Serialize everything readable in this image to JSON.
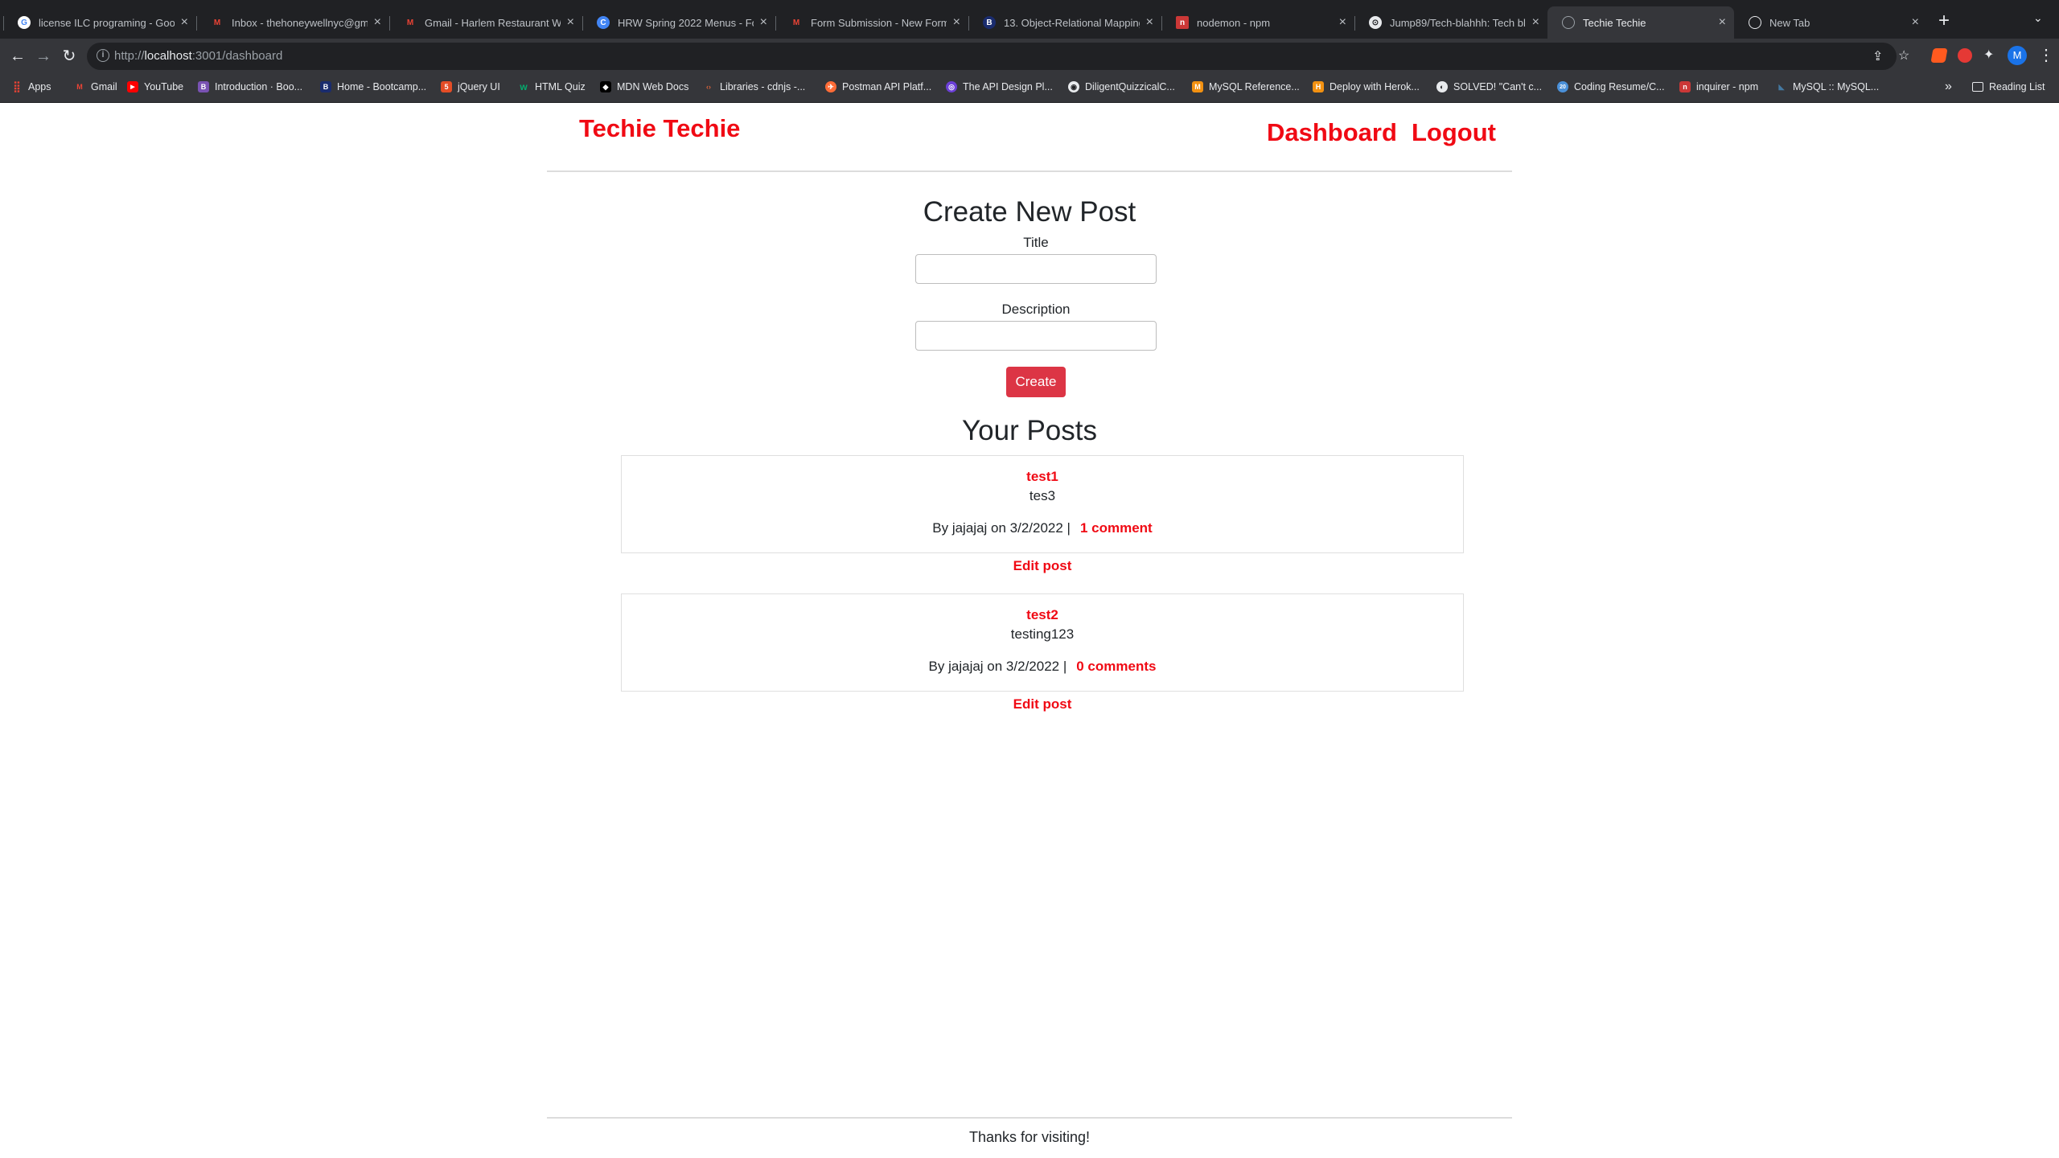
{
  "browser": {
    "tabs": [
      {
        "label": "license ILC programing - Goog",
        "icon": "google-icon",
        "color": "#ffffff",
        "glyph": "G"
      },
      {
        "label": "Inbox - thehoneywellnyc@gma",
        "icon": "gmail-icon",
        "color": "#ea4335",
        "glyph": "M"
      },
      {
        "label": "Gmail - Harlem Restaurant We",
        "icon": "gmail-icon",
        "color": "#ea4335",
        "glyph": "M"
      },
      {
        "label": "HRW Spring 2022 Menus - Fo",
        "icon": "hrw-icon",
        "color": "#4285f4",
        "glyph": "C"
      },
      {
        "label": "Form Submission - New Form",
        "icon": "gmail-icon",
        "color": "#ea4335",
        "glyph": "M"
      },
      {
        "label": "13. Object-Relational Mapping",
        "icon": "bootcamp-icon",
        "color": "#1a2c6e",
        "glyph": "B"
      },
      {
        "label": "nodemon - npm",
        "icon": "npm-icon",
        "color": "#cb3837",
        "glyph": "n"
      },
      {
        "label": "Jump89/Tech-blahhh: Tech blo",
        "icon": "github-icon",
        "color": "#e8eaed",
        "glyph": "⊙"
      },
      {
        "label": "Techie Techie",
        "icon": "globe-icon",
        "color": "#9aa0a6",
        "glyph": "◍"
      },
      {
        "label": "New Tab",
        "icon": "chrome-icon",
        "color": "#e8eaed",
        "glyph": "◍"
      }
    ],
    "active_tab": 8,
    "url_prefix": "http://",
    "url_host": "localhost",
    "url_path": ":3001/dashboard",
    "profile_initial": "M",
    "bookmarks": [
      {
        "label": "Apps",
        "icon": "apps-grid-icon",
        "color": "#ea4335",
        "glyph": "⋮"
      },
      {
        "label": "Gmail",
        "icon": "gmail-icon",
        "color": "#ea4335",
        "glyph": "M"
      },
      {
        "label": "YouTube",
        "icon": "youtube-icon",
        "color": "#ff0000",
        "glyph": "▶"
      },
      {
        "label": "Introduction · Boo...",
        "icon": "bootstrap-icon",
        "color": "#7952b3",
        "glyph": "B"
      },
      {
        "label": "Home - Bootcamp...",
        "icon": "bootcamp-icon",
        "color": "#1a2c6e",
        "glyph": "B"
      },
      {
        "label": "jQuery UI",
        "icon": "html5-icon",
        "color": "#e44d26",
        "glyph": "5"
      },
      {
        "label": "HTML Quiz",
        "icon": "w3schools-icon",
        "color": "#04aa6d",
        "glyph": "w"
      },
      {
        "label": "MDN Web Docs",
        "icon": "mdn-icon",
        "color": "#000000",
        "glyph": "◆"
      },
      {
        "label": "Libraries - cdnjs -...",
        "icon": "cdnjs-icon",
        "color": "#d9643a",
        "glyph": "‹›"
      },
      {
        "label": "Postman API Platf...",
        "icon": "postman-icon",
        "color": "#ff6c37",
        "glyph": "✈"
      },
      {
        "label": "The API Design Pl...",
        "icon": "api-design-icon",
        "color": "#6b3fd6",
        "glyph": "◎"
      },
      {
        "label": "DiligentQuizzicalC...",
        "icon": "replit-icon",
        "color": "#e8eaed",
        "glyph": "◉"
      },
      {
        "label": "MySQL Reference...",
        "icon": "mysql-icon",
        "color": "#f29111",
        "glyph": "M"
      },
      {
        "label": "Deploy with Herok...",
        "icon": "heroku-icon",
        "color": "#f29111",
        "glyph": "H"
      },
      {
        "label": "SOLVED! \"Can't c...",
        "icon": "solved-icon",
        "color": "#e8eaed",
        "glyph": "◐"
      },
      {
        "label": "Coding Resume/C...",
        "icon": "resume-icon",
        "color": "#4a90d9",
        "glyph": "20"
      },
      {
        "label": "inquirer - npm",
        "icon": "npm-icon",
        "color": "#cb3837",
        "glyph": "n"
      },
      {
        "label": "MySQL :: MySQL...",
        "icon": "mysql-dolphin-icon",
        "color": "#4479a1",
        "glyph": "◣"
      }
    ],
    "reading_list": "Reading List"
  },
  "site": {
    "brand": "Techie Techie",
    "nav": {
      "dashboard": "Dashboard",
      "logout": "Logout"
    },
    "link_color": "#f00a14"
  },
  "create_form": {
    "heading": "Create New Post",
    "title_label": "Title",
    "title_value": "",
    "description_label": "Description",
    "description_value": "",
    "submit_label": "Create",
    "button_color": "#dc3545"
  },
  "your_posts": {
    "heading": "Your Posts",
    "posts": [
      {
        "title": "test1",
        "body": "tes3",
        "meta": "By jajajaj on 3/2/2022 |",
        "comments": "1 comment",
        "edit": "Edit post"
      },
      {
        "title": "test2",
        "body": "testing123",
        "meta": "By jajajaj on 3/2/2022 |",
        "comments": "0 comments",
        "edit": "Edit post"
      }
    ]
  },
  "footer": {
    "text": "Thanks for visiting!"
  }
}
